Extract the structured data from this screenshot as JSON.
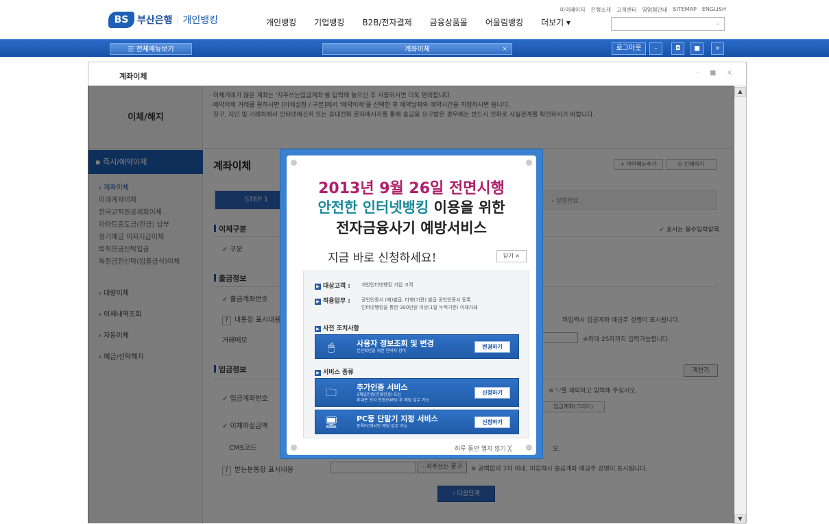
{
  "header": {
    "logo_bs": "BS",
    "logo_name": "부산은행",
    "logo_sub": "개인뱅킹",
    "nav": [
      "개인뱅킹",
      "기업뱅킹",
      "B2B/전자결제",
      "금융상품몰",
      "어울림뱅킹",
      "더보기 ▾"
    ],
    "util": [
      "마이페이지",
      "은행소개",
      "고객센터",
      "영업점안내",
      "SITEMAP",
      "ENGLISH"
    ],
    "search_placeholder": ""
  },
  "bluebar": {
    "all_menu": "☰ 전체메뉴보기",
    "tab": "계좌이체",
    "tab_close": "×",
    "logout": "로그아웃",
    "buttons": [
      "–",
      "◘",
      "■",
      "×"
    ]
  },
  "window": {
    "title": "계좌이체",
    "controls": "– ■ ×"
  },
  "left": {
    "title": "이체/해지",
    "active": "▪ 즉시/예약이체",
    "subitems": [
      "› 계좌이체",
      "미래계좌이체",
      "한국교직원공제회이체",
      "아파트중도금(잔금) 납부",
      "정기예금 이자지급이체",
      "퇴직연금신탁입금",
      "특정금전신탁(입출금식)이체"
    ],
    "mainitems": [
      "› 대량이체",
      "› 이체내역조회",
      "› 자동이체",
      "› 예금/신탁해지"
    ]
  },
  "notice": [
    "· 이체거래가 많은 계좌는 '자주쓰는입금계좌'를 입력해 놓으신 후 사용하시면 더욱 편리합니다.",
    "· 예약이체 거래를 원하시면 [이체설정 / 구분]에서 '예약이체'를 선택한 후 예약날짜와 예약시간을 지정하시면 됩니다.",
    "· 친구, 지인 및 거래처에서 인터넷메신저 또는 휴대전화 문자메시지를 통해 송금을 요구받은 경우에는 반드시 전화로 사실관계를 확인하시기 바랍니다."
  ],
  "page": {
    "title": "계좌이체",
    "my_menu_add": "+ 마이메뉴추가",
    "print": "⎙ 인쇄하기",
    "step1": "STEP 1",
    "step3": "› 실행완료",
    "required_note": "✓ 표시는 필수입력항목",
    "sec_type": "이체구분",
    "row_type": "✓ 구분",
    "sec_out": "출금정보",
    "row_out_acct": "✓ 출금계좌번호",
    "row_passbook": "내통장 표시내용",
    "row_memo": "거래메모",
    "out_hint": "미입력시 입금계좌 예금주 성명이 표시됩니다.",
    "memo_hint": "※최대 25자까지 입력가능합니다.",
    "sec_in": "입금정보",
    "calc": "계산기",
    "row_in_acct": "✓ 입금계좌번호",
    "in_acct_hint": "※ '-'를 제외하고 입력해 주십시오.",
    "in_acct_btn": "입금계좌(그리드)",
    "row_amount": "✓ 이체하실금액",
    "row_cms": "CMS코드",
    "cms_hint": "오.",
    "row_recv": "받는분통장 표시내용",
    "phrase_btn": "· 자주쓰는 문구",
    "recv_hint": "※ 공백없이 7자 이내, 미입력시 출금계좌 예금주 성명이 표시됩니다.",
    "next": "› 다음단계"
  },
  "popup": {
    "h1": "2013년 9월 26일 전면시행",
    "h2_hl": "안전한 인터넷뱅킹",
    "h2_rest": " 이용을 위한",
    "h3": "전자금융사기 예방서비스",
    "h4": "지금 바로 신청하세요!",
    "close": "닫기 ×",
    "target_label": "대상고객 :",
    "target_text": "개인인터넷뱅킹 가입 고객",
    "scope_label": "적용업무 :",
    "scope_text1": "공인인증서 (재)발급, 타행(기관) 발급 공인인증서 등록",
    "scope_text2": "인터넷뱅킹을 통한 300만원 이상(1일 누적기준) 이체거래",
    "prep_label": "사전 조치사항",
    "card1_title": "사용자 정보조회 및 변경",
    "card1_desc": "본인확인을 위한 연락처 정비",
    "card1_btn": "변경하기",
    "svc_label": "서비스 종류",
    "card2_title": "추가인증 서비스",
    "card2_desc1": "2채널인증(전화인증) 또는",
    "card2_desc2": "휴대폰 문자 인증(SMS) 후 해당 업무 가능",
    "card2_btn": "신청하기",
    "card3_title": "PC등 단말기 지정 서비스",
    "card3_desc": "등록PC에서만 해당 업무 가능",
    "card3_btn": "신청하기",
    "today_close": "하루 동안 열지 않기 ╳"
  }
}
